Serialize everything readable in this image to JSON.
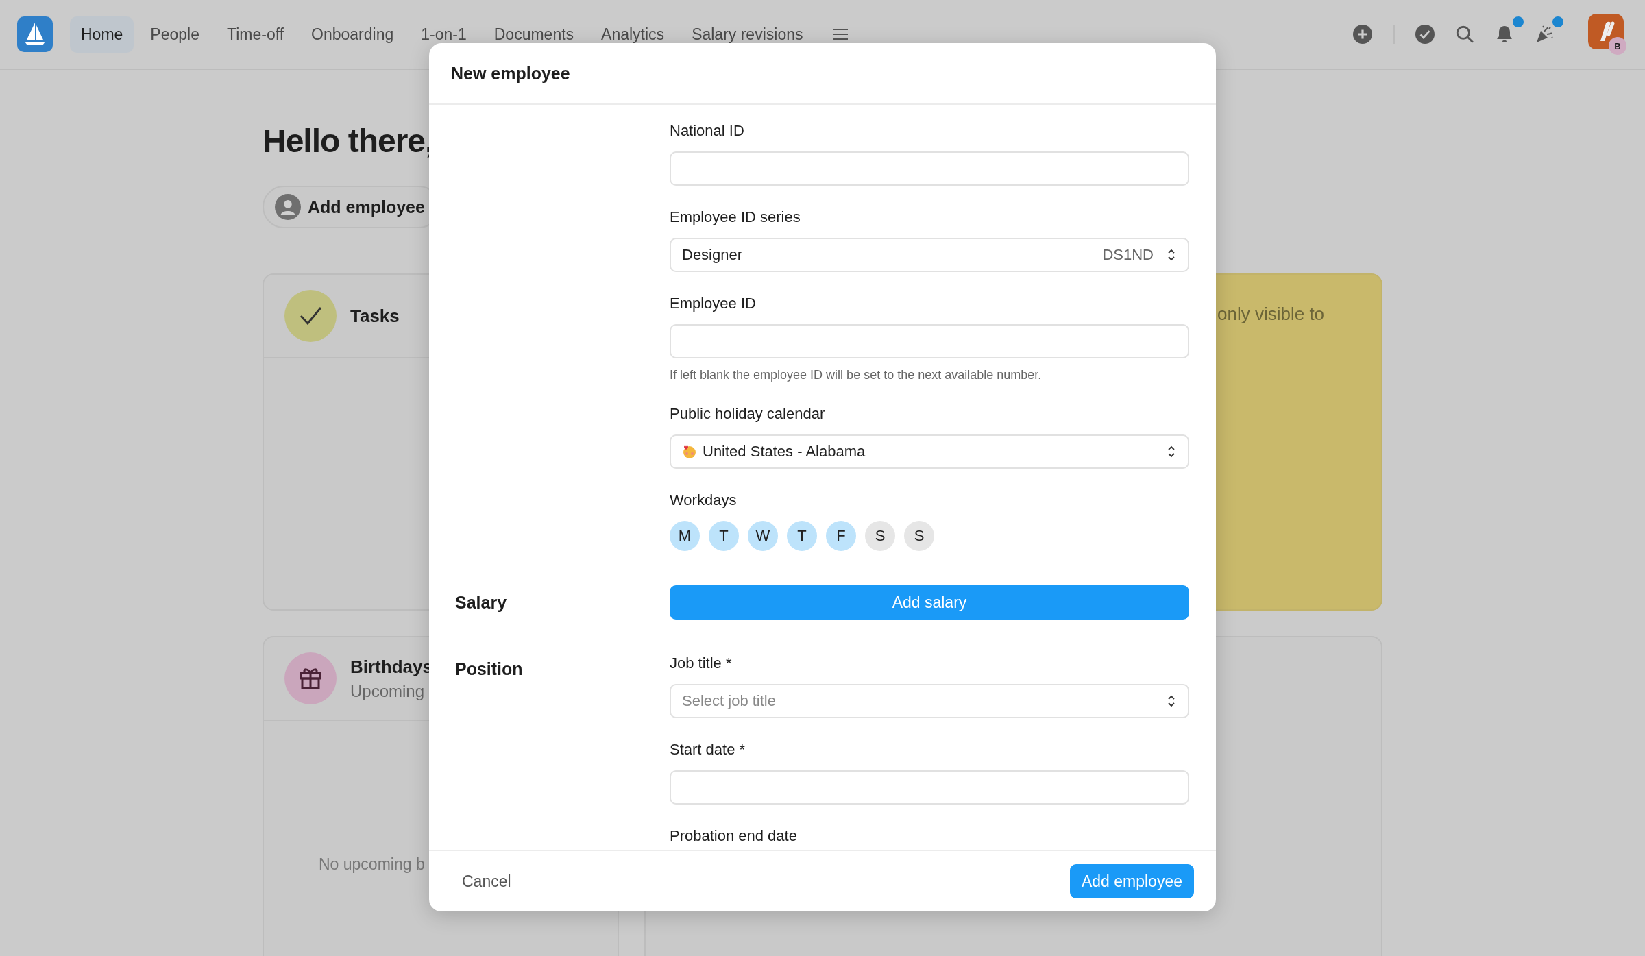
{
  "nav": {
    "items": [
      {
        "label": "Home",
        "selected": true
      },
      {
        "label": "People",
        "selected": false
      },
      {
        "label": "Time-off",
        "selected": false
      },
      {
        "label": "Onboarding",
        "selected": false
      },
      {
        "label": "1-on-1",
        "selected": false
      },
      {
        "label": "Documents",
        "selected": false
      },
      {
        "label": "Analytics",
        "selected": false
      },
      {
        "label": "Salary revisions",
        "selected": false
      }
    ]
  },
  "top_actions": {
    "bell_unread": true,
    "celebrations_unread": true,
    "avatar_badge": "B"
  },
  "background": {
    "greeting": "Hello there,",
    "add_button": "Add employee",
    "tasks_card": {
      "title": "Tasks"
    },
    "notice_card": {
      "text": "only visible to"
    },
    "birthdays_card": {
      "title": "Birthdays",
      "subtitle": "Upcoming",
      "empty_text": "No upcoming b"
    }
  },
  "modal": {
    "title": "New employee",
    "sections": [
      {
        "fields": [
          {
            "kind": "input",
            "label": "National ID"
          },
          {
            "kind": "select",
            "label": "Employee ID series",
            "value": "Designer",
            "code": "DS1ND"
          },
          {
            "kind": "input",
            "label": "Employee ID",
            "hint": "If left blank the employee ID will be set to the next available number."
          },
          {
            "kind": "icon-select",
            "label": "Public holiday calendar",
            "value": "United States - Alabama"
          },
          {
            "kind": "workdays",
            "label": "Workdays",
            "days": [
              {
                "label": "M",
                "selected": true
              },
              {
                "label": "T",
                "selected": true
              },
              {
                "label": "W",
                "selected": true
              },
              {
                "label": "T",
                "selected": true
              },
              {
                "label": "F",
                "selected": true
              },
              {
                "label": "S",
                "selected": false
              },
              {
                "label": "S",
                "selected": false
              }
            ]
          }
        ]
      },
      {
        "heading": "Salary",
        "fields": [
          {
            "kind": "button",
            "label": "Add salary"
          }
        ]
      },
      {
        "heading": "Position",
        "fields": [
          {
            "kind": "select",
            "label": "Job title *",
            "placeholder": "Select job title"
          },
          {
            "kind": "input",
            "label": "Start date *"
          },
          {
            "kind": "label",
            "label": "Probation end date"
          }
        ]
      }
    ],
    "footer": {
      "cancel": "Cancel",
      "submit": "Add employee"
    }
  }
}
